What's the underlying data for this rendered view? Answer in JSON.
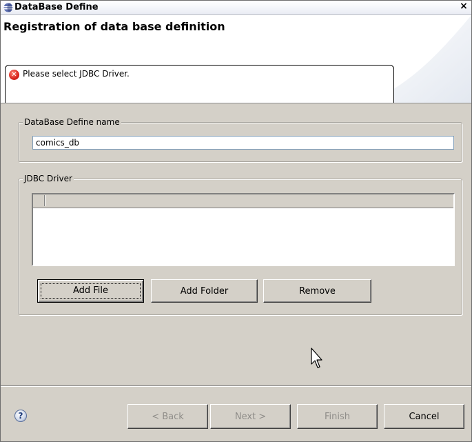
{
  "window": {
    "title": "DataBase Define",
    "close_glyph": "×"
  },
  "header": {
    "title": "Registration of data base definition",
    "message": "Please select JDBC Driver.",
    "message_icon": "error-icon"
  },
  "define_group": {
    "legend": "DataBase Define name",
    "name_value": "comics_db"
  },
  "driver_group": {
    "legend": "JDBC Driver",
    "add_file_label": "Add File",
    "add_folder_label": "Add Folder",
    "remove_label": "Remove"
  },
  "footer": {
    "help_glyph": "?",
    "back_label": "< Back",
    "next_label": "Next >",
    "finish_label": "Finish",
    "cancel_label": "Cancel"
  },
  "colors": {
    "dialog_bg": "#d4d0c8",
    "error_red": "#d8231b",
    "disabled_text": "#8f8d89"
  }
}
